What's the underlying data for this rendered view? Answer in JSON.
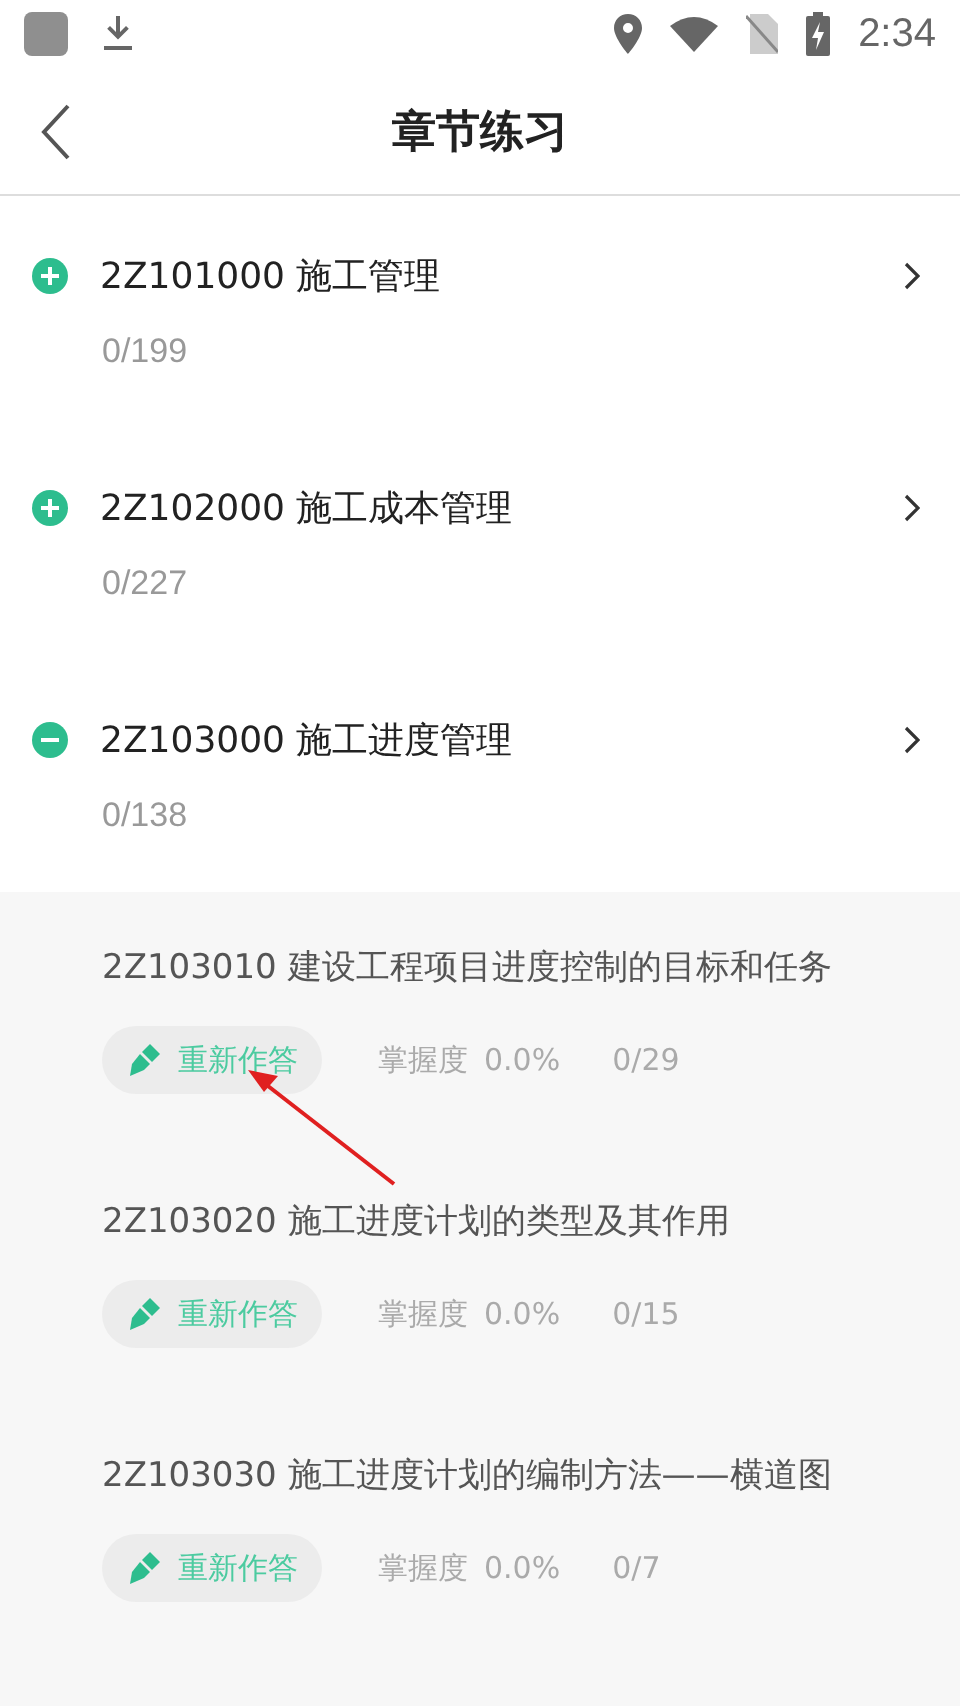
{
  "status_bar": {
    "time": "2:34"
  },
  "header": {
    "title": "章节练习"
  },
  "chapters": [
    {
      "code": "2Z101000 施工管理",
      "count": "0/199",
      "expanded": false
    },
    {
      "code": "2Z102000 施工成本管理",
      "count": "0/227",
      "expanded": false
    },
    {
      "code": "2Z103000 施工进度管理",
      "count": "0/138",
      "expanded": true,
      "children": [
        {
          "title": "2Z103010 建设工程项目进度控制的目标和任务",
          "button": "重新作答",
          "mastery_label": "掌握度",
          "mastery": "0.0%",
          "count": "0/29"
        },
        {
          "title": "2Z103020 施工进度计划的类型及其作用",
          "button": "重新作答",
          "mastery_label": "掌握度",
          "mastery": "0.0%",
          "count": "0/15"
        },
        {
          "title": "2Z103030 施工进度计划的编制方法——横道图",
          "button": "重新作答",
          "mastery_label": "掌握度",
          "mastery": "0.0%",
          "count": "0/7"
        }
      ]
    }
  ]
}
